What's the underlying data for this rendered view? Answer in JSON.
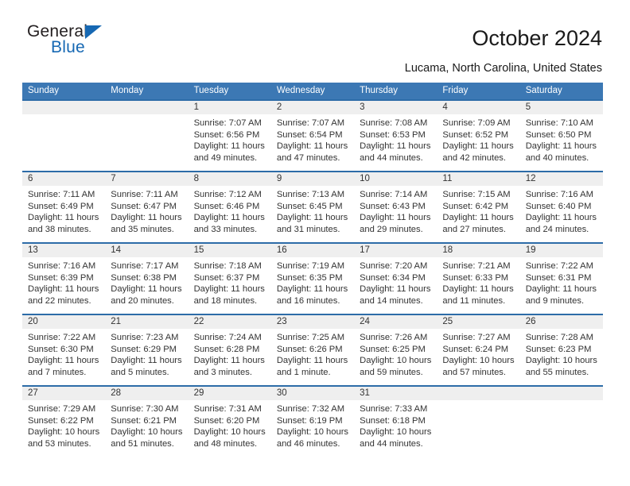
{
  "brand": {
    "name_part1": "General",
    "name_part2": "Blue",
    "accent_color": "#1668b3",
    "triangle_icon": "triangle-icon"
  },
  "header": {
    "title": "October 2024",
    "subtitle": "Lucama, North Carolina, United States"
  },
  "calendar": {
    "header_bg": "#3c78b4",
    "row_divider_color": "#2d6ca8",
    "daynum_band_bg": "#efefef",
    "weekday_headers": [
      "Sunday",
      "Monday",
      "Tuesday",
      "Wednesday",
      "Thursday",
      "Friday",
      "Saturday"
    ],
    "weeks": [
      [
        {
          "day": "",
          "blank": true
        },
        {
          "day": "",
          "blank": true
        },
        {
          "day": "1",
          "sunrise": "Sunrise: 7:07 AM",
          "sunset": "Sunset: 6:56 PM",
          "daylight_line1": "Daylight: 11 hours",
          "daylight_line2": "and 49 minutes."
        },
        {
          "day": "2",
          "sunrise": "Sunrise: 7:07 AM",
          "sunset": "Sunset: 6:54 PM",
          "daylight_line1": "Daylight: 11 hours",
          "daylight_line2": "and 47 minutes."
        },
        {
          "day": "3",
          "sunrise": "Sunrise: 7:08 AM",
          "sunset": "Sunset: 6:53 PM",
          "daylight_line1": "Daylight: 11 hours",
          "daylight_line2": "and 44 minutes."
        },
        {
          "day": "4",
          "sunrise": "Sunrise: 7:09 AM",
          "sunset": "Sunset: 6:52 PM",
          "daylight_line1": "Daylight: 11 hours",
          "daylight_line2": "and 42 minutes."
        },
        {
          "day": "5",
          "sunrise": "Sunrise: 7:10 AM",
          "sunset": "Sunset: 6:50 PM",
          "daylight_line1": "Daylight: 11 hours",
          "daylight_line2": "and 40 minutes."
        }
      ],
      [
        {
          "day": "6",
          "sunrise": "Sunrise: 7:11 AM",
          "sunset": "Sunset: 6:49 PM",
          "daylight_line1": "Daylight: 11 hours",
          "daylight_line2": "and 38 minutes."
        },
        {
          "day": "7",
          "sunrise": "Sunrise: 7:11 AM",
          "sunset": "Sunset: 6:47 PM",
          "daylight_line1": "Daylight: 11 hours",
          "daylight_line2": "and 35 minutes."
        },
        {
          "day": "8",
          "sunrise": "Sunrise: 7:12 AM",
          "sunset": "Sunset: 6:46 PM",
          "daylight_line1": "Daylight: 11 hours",
          "daylight_line2": "and 33 minutes."
        },
        {
          "day": "9",
          "sunrise": "Sunrise: 7:13 AM",
          "sunset": "Sunset: 6:45 PM",
          "daylight_line1": "Daylight: 11 hours",
          "daylight_line2": "and 31 minutes."
        },
        {
          "day": "10",
          "sunrise": "Sunrise: 7:14 AM",
          "sunset": "Sunset: 6:43 PM",
          "daylight_line1": "Daylight: 11 hours",
          "daylight_line2": "and 29 minutes."
        },
        {
          "day": "11",
          "sunrise": "Sunrise: 7:15 AM",
          "sunset": "Sunset: 6:42 PM",
          "daylight_line1": "Daylight: 11 hours",
          "daylight_line2": "and 27 minutes."
        },
        {
          "day": "12",
          "sunrise": "Sunrise: 7:16 AM",
          "sunset": "Sunset: 6:40 PM",
          "daylight_line1": "Daylight: 11 hours",
          "daylight_line2": "and 24 minutes."
        }
      ],
      [
        {
          "day": "13",
          "sunrise": "Sunrise: 7:16 AM",
          "sunset": "Sunset: 6:39 PM",
          "daylight_line1": "Daylight: 11 hours",
          "daylight_line2": "and 22 minutes."
        },
        {
          "day": "14",
          "sunrise": "Sunrise: 7:17 AM",
          "sunset": "Sunset: 6:38 PM",
          "daylight_line1": "Daylight: 11 hours",
          "daylight_line2": "and 20 minutes."
        },
        {
          "day": "15",
          "sunrise": "Sunrise: 7:18 AM",
          "sunset": "Sunset: 6:37 PM",
          "daylight_line1": "Daylight: 11 hours",
          "daylight_line2": "and 18 minutes."
        },
        {
          "day": "16",
          "sunrise": "Sunrise: 7:19 AM",
          "sunset": "Sunset: 6:35 PM",
          "daylight_line1": "Daylight: 11 hours",
          "daylight_line2": "and 16 minutes."
        },
        {
          "day": "17",
          "sunrise": "Sunrise: 7:20 AM",
          "sunset": "Sunset: 6:34 PM",
          "daylight_line1": "Daylight: 11 hours",
          "daylight_line2": "and 14 minutes."
        },
        {
          "day": "18",
          "sunrise": "Sunrise: 7:21 AM",
          "sunset": "Sunset: 6:33 PM",
          "daylight_line1": "Daylight: 11 hours",
          "daylight_line2": "and 11 minutes."
        },
        {
          "day": "19",
          "sunrise": "Sunrise: 7:22 AM",
          "sunset": "Sunset: 6:31 PM",
          "daylight_line1": "Daylight: 11 hours",
          "daylight_line2": "and 9 minutes."
        }
      ],
      [
        {
          "day": "20",
          "sunrise": "Sunrise: 7:22 AM",
          "sunset": "Sunset: 6:30 PM",
          "daylight_line1": "Daylight: 11 hours",
          "daylight_line2": "and 7 minutes."
        },
        {
          "day": "21",
          "sunrise": "Sunrise: 7:23 AM",
          "sunset": "Sunset: 6:29 PM",
          "daylight_line1": "Daylight: 11 hours",
          "daylight_line2": "and 5 minutes."
        },
        {
          "day": "22",
          "sunrise": "Sunrise: 7:24 AM",
          "sunset": "Sunset: 6:28 PM",
          "daylight_line1": "Daylight: 11 hours",
          "daylight_line2": "and 3 minutes."
        },
        {
          "day": "23",
          "sunrise": "Sunrise: 7:25 AM",
          "sunset": "Sunset: 6:26 PM",
          "daylight_line1": "Daylight: 11 hours",
          "daylight_line2": "and 1 minute."
        },
        {
          "day": "24",
          "sunrise": "Sunrise: 7:26 AM",
          "sunset": "Sunset: 6:25 PM",
          "daylight_line1": "Daylight: 10 hours",
          "daylight_line2": "and 59 minutes."
        },
        {
          "day": "25",
          "sunrise": "Sunrise: 7:27 AM",
          "sunset": "Sunset: 6:24 PM",
          "daylight_line1": "Daylight: 10 hours",
          "daylight_line2": "and 57 minutes."
        },
        {
          "day": "26",
          "sunrise": "Sunrise: 7:28 AM",
          "sunset": "Sunset: 6:23 PM",
          "daylight_line1": "Daylight: 10 hours",
          "daylight_line2": "and 55 minutes."
        }
      ],
      [
        {
          "day": "27",
          "sunrise": "Sunrise: 7:29 AM",
          "sunset": "Sunset: 6:22 PM",
          "daylight_line1": "Daylight: 10 hours",
          "daylight_line2": "and 53 minutes."
        },
        {
          "day": "28",
          "sunrise": "Sunrise: 7:30 AM",
          "sunset": "Sunset: 6:21 PM",
          "daylight_line1": "Daylight: 10 hours",
          "daylight_line2": "and 51 minutes."
        },
        {
          "day": "29",
          "sunrise": "Sunrise: 7:31 AM",
          "sunset": "Sunset: 6:20 PM",
          "daylight_line1": "Daylight: 10 hours",
          "daylight_line2": "and 48 minutes."
        },
        {
          "day": "30",
          "sunrise": "Sunrise: 7:32 AM",
          "sunset": "Sunset: 6:19 PM",
          "daylight_line1": "Daylight: 10 hours",
          "daylight_line2": "and 46 minutes."
        },
        {
          "day": "31",
          "sunrise": "Sunrise: 7:33 AM",
          "sunset": "Sunset: 6:18 PM",
          "daylight_line1": "Daylight: 10 hours",
          "daylight_line2": "and 44 minutes."
        },
        {
          "day": "",
          "blank": true
        },
        {
          "day": "",
          "blank": true
        }
      ]
    ]
  }
}
